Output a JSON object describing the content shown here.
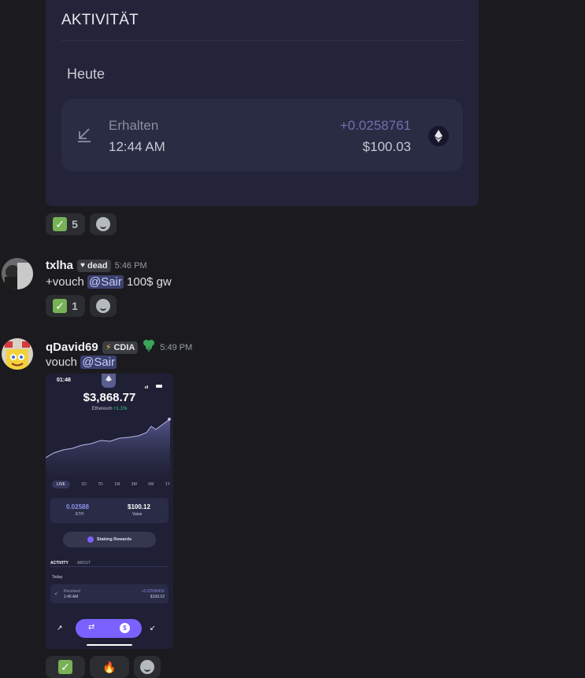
{
  "embed": {
    "title": "AKTIVITÄT",
    "section": "Heute",
    "transaction": {
      "label": "Erhalten",
      "time": "12:44 AM",
      "amount": "+0.0258761",
      "usd": "$100.03"
    }
  },
  "reactions_top": {
    "check_count": "5"
  },
  "messages": [
    {
      "username": "txlha",
      "tag": "dead",
      "time": "5:46 PM",
      "text_before": "+vouch ",
      "mention": "@Sair",
      "text_after": " 100$ gw",
      "reaction_count": "1"
    },
    {
      "username": "qDavid69",
      "tag": "CDIA",
      "time": "5:49 PM",
      "text_before": "vouch ",
      "mention": "@Sair"
    }
  ],
  "phone": {
    "clock": "01:48",
    "price": "$3,868.77",
    "asset": "Ethereum",
    "change": "+1.1%",
    "ranges": [
      "LIVE",
      "1D",
      "7D",
      "1M",
      "3M",
      "6M",
      "1Y"
    ],
    "holding_amount": "0.02588",
    "holding_unit": "ETH",
    "value_amount": "$100.12",
    "value_label": "Value",
    "staking": "Staking Rewards",
    "tabs": [
      "ACTIVITY",
      "ABOUT"
    ],
    "today": "Today",
    "tx_label": "Received",
    "tx_time": "1:46 AM",
    "tx_amount": "+0.02588436",
    "tx_usd": "$100.02"
  },
  "colors": {
    "background": "#1b1b1f",
    "embed": "#23243a",
    "accent": "#7b61ff",
    "check": "#77b255",
    "mention": "#3c4270"
  }
}
